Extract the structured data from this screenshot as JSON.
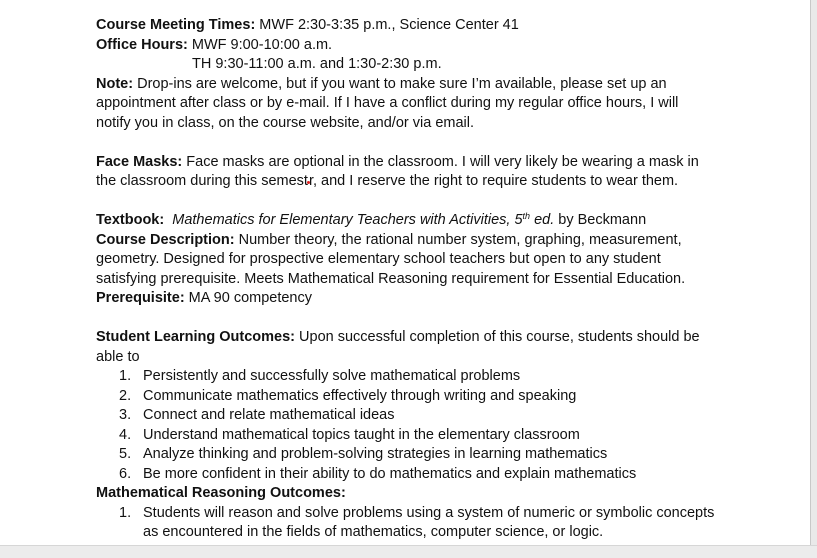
{
  "meeting": {
    "label": "Course Meeting Times:",
    "value": " MWF 2:30-3:35 p.m., Science Center 41"
  },
  "office_hours": {
    "label": "Office Hours:",
    "line1": "  MWF 9:00-10:00 a.m.",
    "line2": "TH 9:30-11:00 a.m. and 1:30-2:30 p.m."
  },
  "note": {
    "label": "Note:",
    "lines": [
      "   Drop-ins are welcome, but if you want to make sure I’m available, please set up an",
      "appointment  after class or by e-mail.  If I have a conflict during my regular office hours, I will",
      "notify you in class, on the course website, and/or via email."
    ]
  },
  "masks": {
    "label": "Face Masks:",
    "line1": "  Face masks are optional in the classroom.  I will very likely be wearing a mask in",
    "line2a": "the classroom during this semest",
    "line2b": "r, and I reserve the right to require students to wear them."
  },
  "textbook": {
    "label": "Textbook:",
    "title": "Mathematics for Elementary Teachers with Activities, 5",
    "sup": "th",
    "edition": " ed.",
    "author": " by Beckmann"
  },
  "description": {
    "label": "Course Description:",
    "lines": [
      "  Number theory, the rational number system, graphing, measurement,",
      "geometry. Designed for prospective elementary school teachers but open to any student",
      "satisfying prerequisite. Meets Mathematical Reasoning requirement for Essential Education."
    ]
  },
  "prerequisite": {
    "label": "Prerequisite:",
    "value": "  MA 90 competency"
  },
  "slo": {
    "label": "Student Learning Outcomes:",
    "line1": "  Upon successful completion of this course, students should be",
    "line2": "able to",
    "items": [
      {
        "num": "1.",
        "text": "Persistently and successfully solve mathematical problems"
      },
      {
        "num": "2.",
        "text": "Communicate mathematics effectively through writing and speaking"
      },
      {
        "num": "3.",
        "text": "Connect and relate mathematical ideas"
      },
      {
        "num": "4.",
        "text": "Understand mathematical topics taught in the elementary classroom"
      },
      {
        "num": "5.",
        "text": "Analyze thinking and problem-solving strategies in learning mathematics"
      },
      {
        "num": "6.",
        "text": "Be more confident in their ability to do mathematics and explain mathematics"
      }
    ]
  },
  "mro": {
    "label": "Mathematical Reasoning Outcomes:",
    "items": [
      {
        "num": "1.",
        "line1": "Students will reason and solve problems using a system of numeric or symbolic concepts",
        "line2": "as encountered in the fields of mathematics, computer science, or logic."
      }
    ]
  }
}
